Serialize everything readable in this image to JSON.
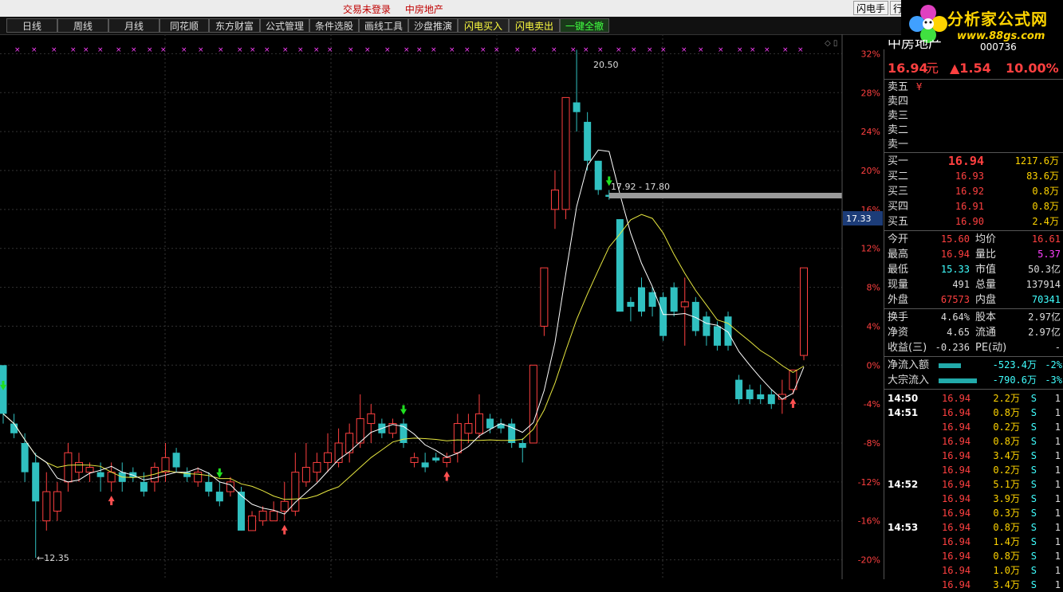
{
  "topbar": {
    "status_login": "交易未登录",
    "stock_name": "中房地产",
    "btn_flash": "闪电手",
    "btn_trade": "行"
  },
  "toolbar": [
    {
      "label": "日线",
      "style": "normal"
    },
    {
      "label": "周线",
      "style": "normal"
    },
    {
      "label": "月线",
      "style": "normal"
    },
    {
      "label": "同花顺",
      "style": "normal"
    },
    {
      "label": "东方财富",
      "style": "normal"
    },
    {
      "label": "公式管理",
      "style": "normal"
    },
    {
      "label": "条件选股",
      "style": "normal"
    },
    {
      "label": "画线工具",
      "style": "normal"
    },
    {
      "label": "沙盘推演",
      "style": "normal"
    },
    {
      "label": "闪电买入",
      "style": "yellow"
    },
    {
      "label": "闪电卖出",
      "style": "yellow"
    },
    {
      "label": "一键全撤",
      "style": "green"
    }
  ],
  "logo": {
    "brand": "分析家公式网",
    "url": "www.88gs.com"
  },
  "chart_labels": {
    "high": "20.50",
    "low": "←12.35",
    "range": "17.92 - 17.80",
    "price_tag": "17.33"
  },
  "chart_data": {
    "type": "candlestick",
    "y_axis_ticks": [
      "32%",
      "28%",
      "24%",
      "20%",
      "16%",
      "12%",
      "8%",
      "4%",
      "0%",
      "-4%",
      "-8%",
      "-12%",
      "-16%",
      "-20%"
    ],
    "y_range_pct": [
      -22,
      34
    ],
    "base_price": 15.4,
    "candles": [
      {
        "o": 0,
        "c": -5,
        "h": -3,
        "l": -6
      },
      {
        "o": -6,
        "c": -7,
        "h": -5,
        "l": -7.5
      },
      {
        "o": -8,
        "c": -11,
        "h": -7,
        "l": -12
      },
      {
        "o": -10,
        "c": -14,
        "h": -9,
        "l": -19.8
      },
      {
        "o": -16,
        "c": -13,
        "h": -11,
        "l": -17
      },
      {
        "o": -15,
        "c": -13,
        "h": -12,
        "l": -16
      },
      {
        "o": -12,
        "c": -9,
        "h": -8,
        "l": -13
      },
      {
        "o": -11,
        "c": -10,
        "h": -9,
        "l": -12
      },
      {
        "o": -11,
        "c": -10.5,
        "h": -10,
        "l": -12
      },
      {
        "o": -11,
        "c": -11.5,
        "h": -10,
        "l": -13
      },
      {
        "o": -12,
        "c": -11,
        "h": -10,
        "l": -13
      },
      {
        "o": -11,
        "c": -12,
        "h": -10,
        "l": -13
      },
      {
        "o": -11,
        "c": -11.5,
        "h": -10.5,
        "l": -12
      },
      {
        "o": -12,
        "c": -13,
        "h": -11,
        "l": -13.5
      },
      {
        "o": -12,
        "c": -10.5,
        "h": -10,
        "l": -13
      },
      {
        "o": -11,
        "c": -9.5,
        "h": -8,
        "l": -12
      },
      {
        "o": -9,
        "c": -10.5,
        "h": -8.5,
        "l": -11
      },
      {
        "o": -11,
        "c": -11.5,
        "h": -10.5,
        "l": -12
      },
      {
        "o": -12,
        "c": -11,
        "h": -10.5,
        "l": -12.5
      },
      {
        "o": -12,
        "c": -13,
        "h": -11,
        "l": -13.5
      },
      {
        "o": -13,
        "c": -14,
        "h": -12,
        "l": -14.5
      },
      {
        "o": -13,
        "c": -12,
        "h": -11.5,
        "l": -13.5
      },
      {
        "o": -13,
        "c": -17,
        "h": -12.5,
        "l": -17
      },
      {
        "o": -17,
        "c": -15.5,
        "h": -15,
        "l": -17
      },
      {
        "o": -16,
        "c": -15,
        "h": -14.5,
        "l": -16.5
      },
      {
        "o": -16,
        "c": -15,
        "h": -14,
        "l": -16
      },
      {
        "o": -15,
        "c": -14,
        "h": -12,
        "l": -16
      },
      {
        "o": -15,
        "c": -11,
        "h": -9,
        "l": -15.5
      },
      {
        "o": -12,
        "c": -10.5,
        "h": -8,
        "l": -12.5
      },
      {
        "o": -11,
        "c": -10,
        "h": -9,
        "l": -12
      },
      {
        "o": -10,
        "c": -9,
        "h": -7,
        "l": -11
      },
      {
        "o": -10,
        "c": -8,
        "h": -6.5,
        "l": -10.5
      },
      {
        "o": -9,
        "c": -7,
        "h": -6,
        "l": -10
      },
      {
        "o": -8,
        "c": -5.5,
        "h": -3,
        "l": -8.5
      },
      {
        "o": -6,
        "c": -5,
        "h": -4,
        "l": -8
      },
      {
        "o": -6,
        "c": -7,
        "h": -5.5,
        "l": -7.5
      },
      {
        "o": -7,
        "c": -6,
        "h": -5.5,
        "l": -7.5
      },
      {
        "o": -6,
        "c": -8,
        "h": -5.5,
        "l": -8.5
      },
      {
        "o": -10,
        "c": -9.5,
        "h": -9,
        "l": -10.5
      },
      {
        "o": -10,
        "c": -10.5,
        "h": -9,
        "l": -11
      },
      {
        "o": -9.5,
        "c": -9.8,
        "h": -9,
        "l": -10
      },
      {
        "o": -10,
        "c": -9.5,
        "h": -9,
        "l": -10.5
      },
      {
        "o": -9,
        "c": -6,
        "h": -5,
        "l": -10
      },
      {
        "o": -7,
        "c": -6,
        "h": -5,
        "l": -8
      },
      {
        "o": -7,
        "c": -5,
        "h": -3,
        "l": -7.5
      },
      {
        "o": -5.5,
        "c": -6.5,
        "h": -5,
        "l": -7
      },
      {
        "o": -6,
        "c": -6.5,
        "h": -5.5,
        "l": -7
      },
      {
        "o": -6,
        "c": -8,
        "h": -5.5,
        "l": -8.5
      },
      {
        "o": -8,
        "c": -8.5,
        "h": -7.5,
        "l": -10
      },
      {
        "o": -8,
        "c": 0,
        "h": 0,
        "l": -8
      },
      {
        "o": 4,
        "c": 10,
        "h": 10,
        "l": 3
      },
      {
        "o": 16,
        "c": 18,
        "h": 20,
        "l": 14
      },
      {
        "o": 16,
        "c": 27.5,
        "h": 27.5,
        "l": 15
      },
      {
        "o": 27,
        "c": 26,
        "h": 32.4,
        "l": 24
      },
      {
        "o": 25,
        "c": 21,
        "h": 26,
        "l": 20
      },
      {
        "o": 21,
        "c": 18,
        "h": 21,
        "l": 17.5
      },
      {
        "o": 17.5,
        "c": 17.3,
        "h": 18,
        "l": 17
      },
      {
        "o": 15,
        "c": 5.5,
        "h": 15,
        "l": 5.5
      },
      {
        "o": 6.5,
        "c": 6,
        "h": 7,
        "l": 4.5
      },
      {
        "o": 8,
        "c": 5.5,
        "h": 9,
        "l": 5
      },
      {
        "o": 7.5,
        "c": 6,
        "h": 8,
        "l": 5
      },
      {
        "o": 7,
        "c": 3,
        "h": 7.5,
        "l": 2.5
      },
      {
        "o": 8,
        "c": 5.5,
        "h": 8.5,
        "l": 5
      },
      {
        "o": 6,
        "c": 6.5,
        "h": 9,
        "l": 2
      },
      {
        "o": 6.5,
        "c": 3.5,
        "h": 7,
        "l": 3
      },
      {
        "o": 5,
        "c": 3,
        "h": 5.5,
        "l": 2
      },
      {
        "o": 4,
        "c": 2,
        "h": 4.5,
        "l": 1.5
      },
      {
        "o": 5,
        "c": 2,
        "h": 5.5,
        "l": 1.5
      },
      {
        "o": -1.5,
        "c": -3.5,
        "h": -1,
        "l": -4
      },
      {
        "o": -2.5,
        "c": -3.5,
        "h": -2,
        "l": -4
      },
      {
        "o": -3,
        "c": -3.5,
        "h": -2,
        "l": -4
      },
      {
        "o": -3,
        "c": -4,
        "h": -2.5,
        "l": -4.5
      },
      {
        "o": -3.5,
        "c": -3,
        "h": -1.5,
        "l": -5
      },
      {
        "o": -2.5,
        "c": -0.5,
        "h": -0.5,
        "l": -3
      },
      {
        "o": 1,
        "c": 10,
        "h": 10,
        "l": 0.5
      }
    ]
  },
  "quote": {
    "name": "中房地产",
    "code": "000736",
    "price": "16.94",
    "unit": "元",
    "change": "▲1.54",
    "pct": "10.00%",
    "sell": [
      {
        "label": "卖五",
        "price": "",
        "vol": "¥"
      },
      {
        "label": "卖四",
        "price": "",
        "vol": ""
      },
      {
        "label": "卖三",
        "price": "",
        "vol": ""
      },
      {
        "label": "卖二",
        "price": "",
        "vol": ""
      },
      {
        "label": "卖一",
        "price": "",
        "vol": ""
      }
    ],
    "buy": [
      {
        "label": "买一",
        "price": "16.94",
        "vol": "1217.6万"
      },
      {
        "label": "买二",
        "price": "16.93",
        "vol": "83.6万"
      },
      {
        "label": "买三",
        "price": "16.92",
        "vol": "0.8万"
      },
      {
        "label": "买四",
        "price": "16.91",
        "vol": "0.8万"
      },
      {
        "label": "买五",
        "price": "16.90",
        "vol": "2.4万"
      }
    ],
    "stats": [
      [
        {
          "l": "今开",
          "v": "15.60",
          "c": "red"
        },
        {
          "l": "均价",
          "v": "16.61",
          "c": "red"
        }
      ],
      [
        {
          "l": "最高",
          "v": "16.94",
          "c": "red"
        },
        {
          "l": "量比",
          "v": "5.37",
          "c": "mag"
        }
      ],
      [
        {
          "l": "最低",
          "v": "15.33",
          "c": "grn"
        },
        {
          "l": "市值",
          "v": "50.3亿",
          "c": "wht"
        }
      ],
      [
        {
          "l": "现量",
          "v": "491",
          "c": "wht"
        },
        {
          "l": "总量",
          "v": "137914",
          "c": "wht"
        }
      ],
      [
        {
          "l": "外盘",
          "v": "67573",
          "c": "red"
        },
        {
          "l": "内盘",
          "v": "70341",
          "c": "grn"
        }
      ]
    ],
    "stats2": [
      [
        {
          "l": "换手",
          "v": "4.64%",
          "c": "wht"
        },
        {
          "l": "股本",
          "v": "2.97亿",
          "c": "wht"
        }
      ],
      [
        {
          "l": "净资",
          "v": "4.65",
          "c": "wht"
        },
        {
          "l": "流通",
          "v": "2.97亿",
          "c": "wht"
        }
      ],
      [
        {
          "l": "收益(三)",
          "v": "-0.236",
          "c": "wht"
        },
        {
          "l": "PE(动)",
          "v": "-",
          "c": "wht"
        }
      ]
    ],
    "flows": [
      {
        "label": "净流入额",
        "value": "-523.4万",
        "pct": "-2%",
        "bar_fraction": 0.35
      },
      {
        "label": "大宗流入",
        "value": "-790.6万",
        "pct": "-3%",
        "bar_fraction": 0.6
      }
    ],
    "ticks": [
      {
        "time": "14:50",
        "price": "16.94",
        "vol": "2.2万",
        "side": "S",
        "n": "1"
      },
      {
        "time": "14:51",
        "price": "16.94",
        "vol": "0.8万",
        "side": "S",
        "n": "1"
      },
      {
        "time": "",
        "price": "16.94",
        "vol": "0.2万",
        "side": "S",
        "n": "1"
      },
      {
        "time": "",
        "price": "16.94",
        "vol": "0.8万",
        "side": "S",
        "n": "1"
      },
      {
        "time": "",
        "price": "16.94",
        "vol": "3.4万",
        "side": "S",
        "n": "1"
      },
      {
        "time": "",
        "price": "16.94",
        "vol": "0.2万",
        "side": "S",
        "n": "1"
      },
      {
        "time": "14:52",
        "price": "16.94",
        "vol": "5.1万",
        "side": "S",
        "n": "1"
      },
      {
        "time": "",
        "price": "16.94",
        "vol": "3.9万",
        "side": "S",
        "n": "1"
      },
      {
        "time": "",
        "price": "16.94",
        "vol": "0.3万",
        "side": "S",
        "n": "1"
      },
      {
        "time": "14:53",
        "price": "16.94",
        "vol": "0.8万",
        "side": "S",
        "n": "1"
      },
      {
        "time": "",
        "price": "16.94",
        "vol": "1.4万",
        "side": "S",
        "n": "1"
      },
      {
        "time": "",
        "price": "16.94",
        "vol": "0.8万",
        "side": "S",
        "n": "1"
      },
      {
        "time": "",
        "price": "16.94",
        "vol": "1.0万",
        "side": "S",
        "n": "1"
      },
      {
        "time": "",
        "price": "16.94",
        "vol": "3.4万",
        "side": "S",
        "n": "1"
      }
    ]
  },
  "colors": {
    "up": "#ff4040",
    "down": "#30c0c0",
    "ma_short": "#ffffff",
    "ma_long": "#e8e840",
    "grid": "#3a3a3a",
    "axis_text": "#ff4040"
  }
}
